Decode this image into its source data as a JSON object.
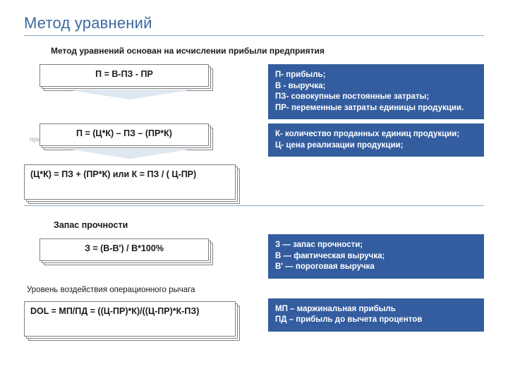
{
  "title": "Метод уравнений",
  "intro": "Метод уравнений основан на исчислении прибыли предприятия",
  "formulas": {
    "profit_basic": "П = В-ПЗ - ПР",
    "profit_expanded": "П =  (Ц*К) – ПЗ – (ПР*К)",
    "break_even": "(Ц*К) = ПЗ + (ПР*К) или К = ПЗ / ( Ц-ПР)",
    "margin_of_safety": "З = (В-В') / В*100%",
    "dol": "DOL = МП/ПД = ((Ц-ПР)*К)/((Ц-ПР)*К-ПЗ)"
  },
  "placeholders": {
    "ghost": "применялось в русской кладке"
  },
  "headers": {
    "safety": "Запас прочности",
    "leverage": "Уровень воздействия операционного рычага"
  },
  "definitions": {
    "box1": [
      "П- прибыль;",
      "В - выручка;",
      "ПЗ- совокупные постоянные затраты;",
      "ПР- переменные затраты единицы продукции."
    ],
    "box2": [
      "К- количество проданных единиц продукции;",
      "Ц- цена реализации продукции;"
    ],
    "box3": [
      "З — запас прочности;",
      "В — фактическая выручка;",
      "В' — пороговая выручка"
    ],
    "box4": [
      "МП – маржинальная прибыль",
      "ПД – прибыль до вычета процентов"
    ]
  }
}
